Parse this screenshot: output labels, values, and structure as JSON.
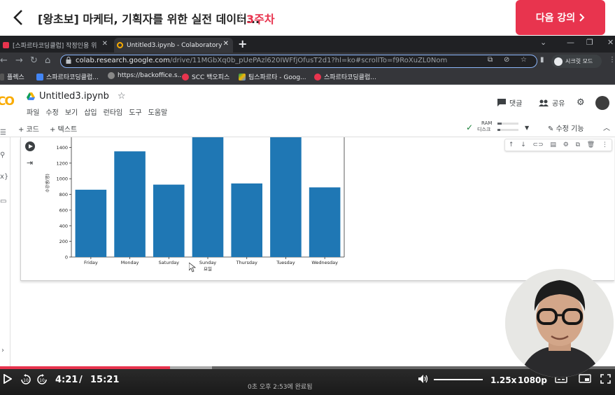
{
  "course": {
    "title": "[왕초보] 마케터, 기획자를 위한 실전 데이터...",
    "week": "3주차",
    "next_button": "다음 강의"
  },
  "browser": {
    "tabs": [
      {
        "label": "[스파르타코딩클럽] 작정인용 위"
      },
      {
        "label": "Untitled3.ipynb - Colaboratory"
      }
    ],
    "url_host": "colab.research.google.com",
    "url_path": "/drive/11MGbXq0b_pUePAzl620IWFfjOfusT2d1?hl=ko#scrollTo=f9RoXuZL0Nom",
    "profile_label": "시크릿 모드",
    "bookmarks": [
      "플렉스",
      "스파르타코딩클럽...",
      "https://backoffice.s...",
      "SCC 백오피스",
      "팀스파르타 - Goog...",
      "스파르타코딩클럽..."
    ]
  },
  "colab": {
    "notebook_title": "Untitled3.ipynb",
    "menu": [
      "파일",
      "수정",
      "보기",
      "삽입",
      "런타임",
      "도구",
      "도움말"
    ],
    "comment_label": "댓글",
    "share_label": "공유",
    "add_code": "+ 코드",
    "add_text": "+ 텍스트",
    "ram_label": "RAM",
    "disk_label": "디스크",
    "edit_mode": "수정 기능"
  },
  "chart_data": {
    "type": "bar",
    "categories": [
      "Friday",
      "Monday",
      "Saturday",
      "Sunday",
      "Thursday",
      "Tuesday",
      "Wednesday"
    ],
    "values": [
      860,
      1350,
      925,
      1530,
      940,
      1530,
      890
    ],
    "xlabel": "요일",
    "ylabel": "수강생(명)",
    "yticks": [
      0,
      200,
      400,
      600,
      800,
      1000,
      1200,
      1400
    ],
    "ylim": [
      0,
      1530
    ],
    "bar_color": "#1f77b4"
  },
  "player": {
    "current_time": "4:21",
    "separator": "/",
    "total_time": "15:21",
    "progress": 0.276,
    "buffered": 0.345,
    "status_text": "0초   오후 2:53에 완료됨",
    "speed": "1.25x",
    "quality": "1080p",
    "accent_color": "#e8344e"
  }
}
